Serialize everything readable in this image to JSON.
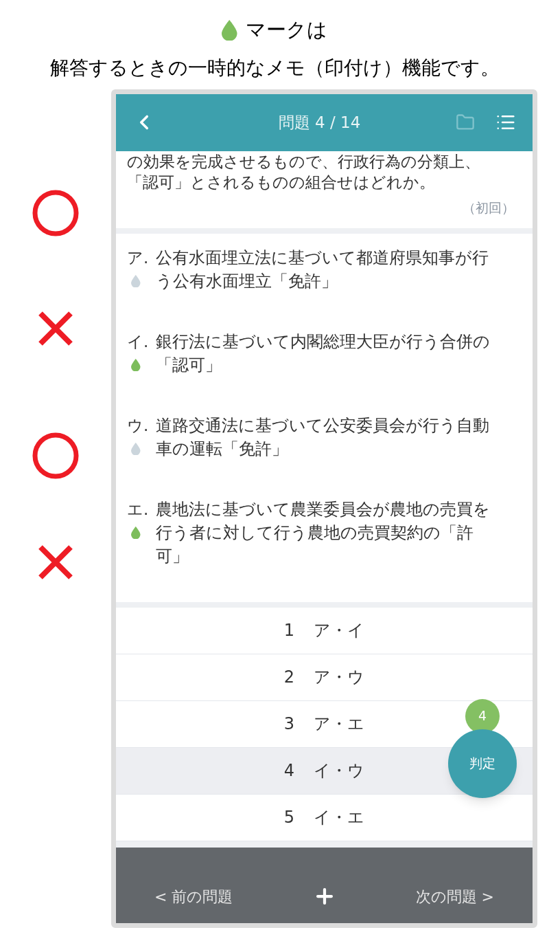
{
  "caption": {
    "line1": "マークは",
    "line2": "解答するときの一時的なメモ（印付け）機能です。"
  },
  "side_marks": [
    {
      "kind": "circle"
    },
    {
      "kind": "cross"
    },
    {
      "kind": "circle"
    },
    {
      "kind": "cross"
    }
  ],
  "header": {
    "title": "問題 4 / 14"
  },
  "question": {
    "lines": [
      "の効果を完成させるもので、行政行為の分類上、",
      "「認可」とされるものの組合せはどれか。"
    ],
    "attempt": "（初回）"
  },
  "statements": [
    {
      "label": "ア.",
      "text": "公有水面埋立法に基づいて都道府県知事が行う公有水面埋立「免許」",
      "marked": false
    },
    {
      "label": "イ.",
      "text": "銀行法に基づいて内閣総理大臣が行う合併の「認可」",
      "marked": true
    },
    {
      "label": "ウ.",
      "text": "道路交通法に基づいて公安委員会が行う自動車の運転「免許」",
      "marked": false
    },
    {
      "label": "エ.",
      "text": "農地法に基づいて農業委員会が農地の売買を行う者に対して行う農地の売買契約の「許可」",
      "marked": true
    }
  ],
  "choices": [
    {
      "number": "1",
      "label": "ア・イ",
      "selected": false
    },
    {
      "number": "2",
      "label": "ア・ウ",
      "selected": false
    },
    {
      "number": "3",
      "label": "ア・エ",
      "selected": false
    },
    {
      "number": "4",
      "label": "イ・ウ",
      "selected": true
    },
    {
      "number": "5",
      "label": "イ・エ",
      "selected": false
    }
  ],
  "answer_badge": "4",
  "judge_button": "判定",
  "footer": {
    "prev": "< 前の問題",
    "next": "次の問題 >"
  }
}
